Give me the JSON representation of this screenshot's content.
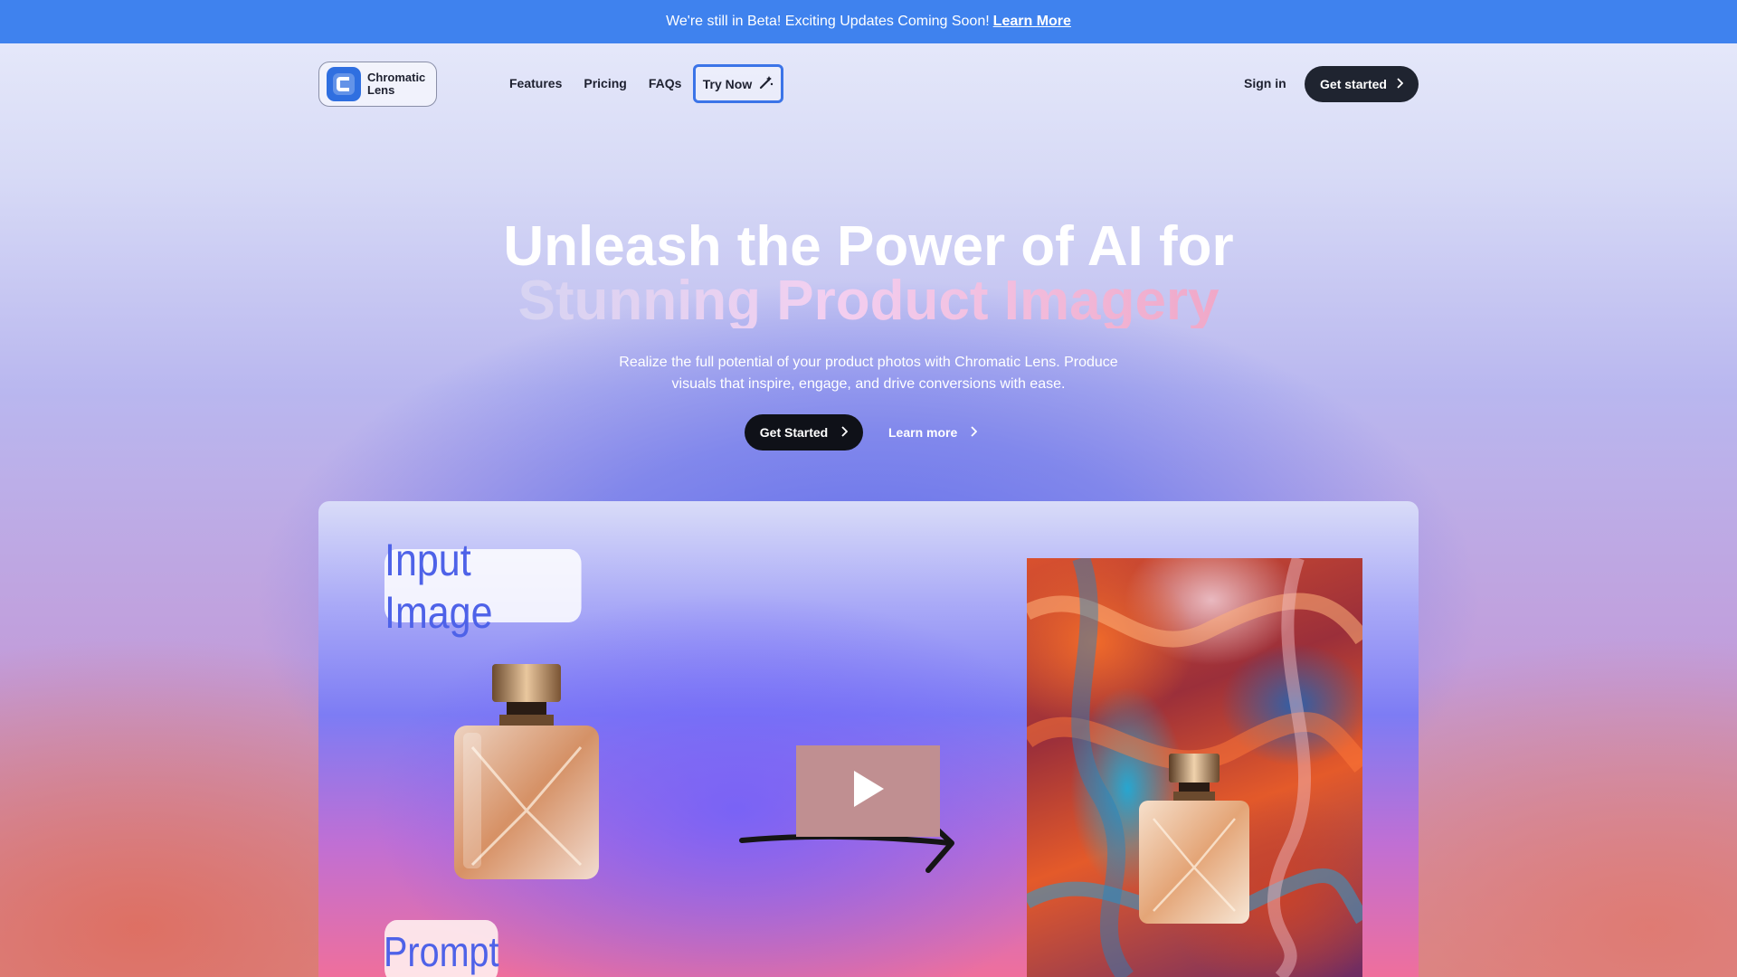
{
  "banner": {
    "text": "We're still in Beta! Exciting Updates Coming Soon!",
    "link": "Learn More"
  },
  "nav": {
    "logo_line1": "Chromatic",
    "logo_line2": "Lens",
    "links": [
      "Features",
      "Pricing",
      "FAQs"
    ],
    "try_now": "Try Now",
    "sign_in": "Sign in",
    "get_started": "Get started"
  },
  "hero": {
    "title_line1": "Unleash the Power of AI for",
    "title_line2": "Stunning Product Imagery",
    "subtitle": "Realize the full potential of your product photos with Chromatic Lens. Produce visuals that inspire, engage, and drive conversions with ease.",
    "cta_primary": "Get Started",
    "cta_secondary": "Learn more"
  },
  "demo": {
    "input_label": "Input Image",
    "prompt_label": "Prompt"
  },
  "icons": {
    "logo": "logo-c-icon",
    "try_now": "magic-wand-icon",
    "chevron": "chevron-right-icon",
    "play": "play-icon",
    "arrow": "arrow-right-icon"
  },
  "colors": {
    "banner": "#3f82ee",
    "dark_button": "#1f2430",
    "accent": "#3b74e8",
    "label_text": "#4e62e8"
  }
}
